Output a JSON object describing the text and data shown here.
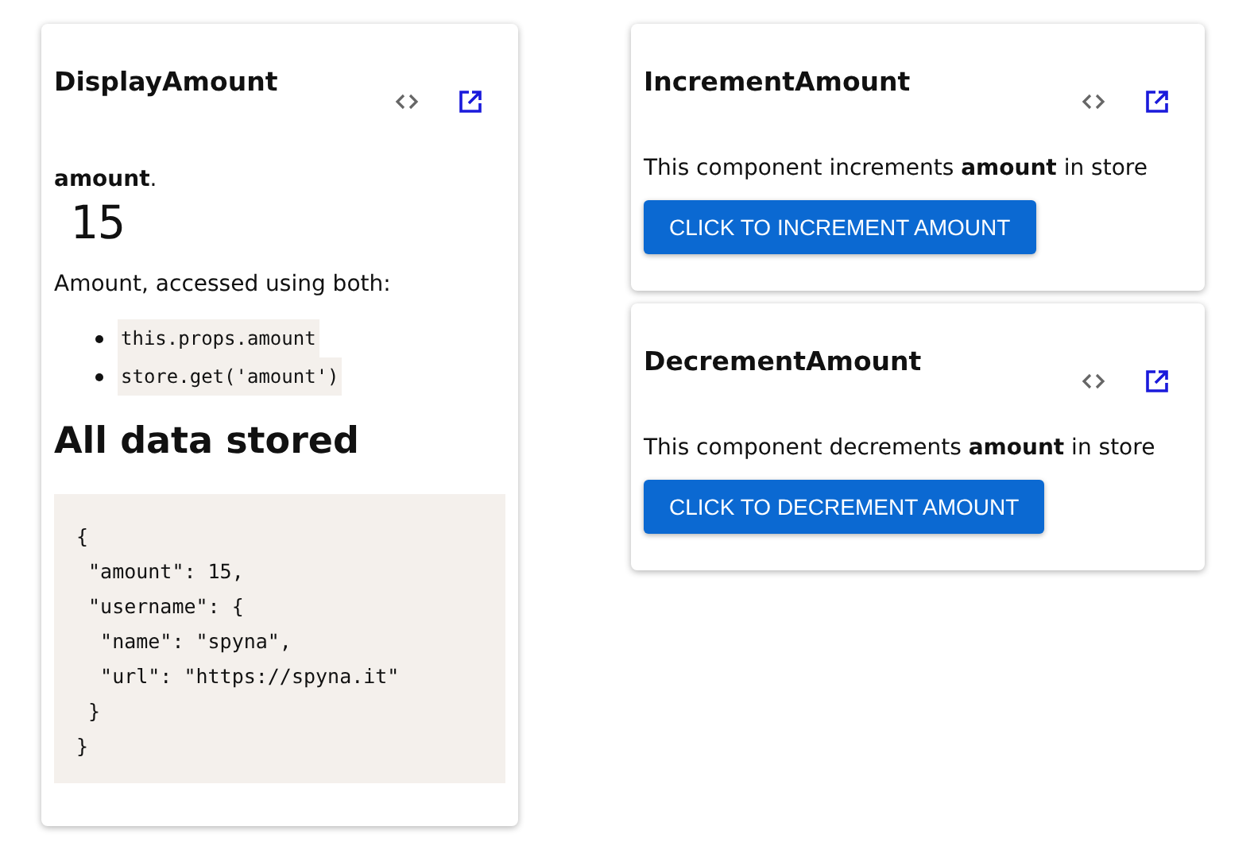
{
  "display_card": {
    "title": "DisplayAmount",
    "amount_label": "**amount**.",
    "amount_value": "15",
    "access_text": "Amount, accessed using both:",
    "access_list": [
      "this.props.amount",
      "store.get('amount')"
    ],
    "store_heading": "All data stored",
    "store_code": [
      "{",
      " \"amount\": 15,",
      " \"username\": {",
      "  \"name\": \"spyna\",",
      "  \"url\": \"https://spyna.it\"",
      " }",
      "}"
    ]
  },
  "action_cards": [
    {
      "title": "IncrementAmount",
      "description": "This component increments **amount** in store",
      "button": "CLICK TO INCREMENT AMOUNT"
    },
    {
      "title": "DecrementAmount",
      "description": "This component decrements **amount** in store",
      "button": "CLICK TO DECREMENT AMOUNT"
    }
  ]
}
